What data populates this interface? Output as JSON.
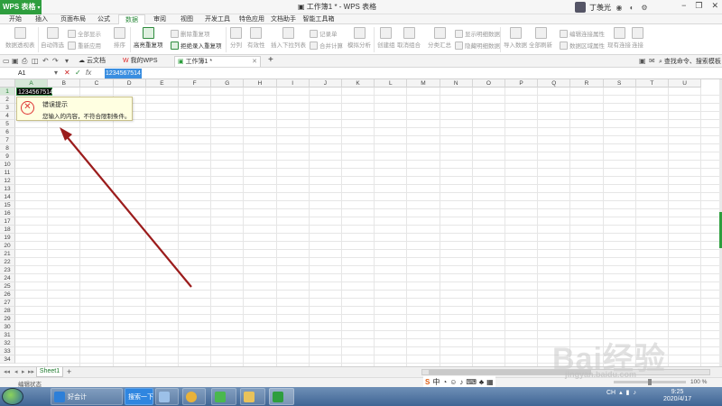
{
  "app": {
    "badge": "WPS 表格",
    "document_title": "工作簿1 * - WPS 表格",
    "user_name": "丁羡光"
  },
  "menu_tabs": [
    "开始",
    "插入",
    "页面布局",
    "公式",
    "数据",
    "审阅",
    "视图",
    "开发工具",
    "特色应用",
    "文档助手",
    "智能工具箱"
  ],
  "active_tab": "数据",
  "ribbon": {
    "pivot": "数据透视表",
    "auto_filter": "自动筛选",
    "show_all": "全部显示",
    "reapply": "重新应用",
    "sort": "排序",
    "highlight_duplicates": "高亮重复项",
    "delete_duplicates": "删除重复项",
    "reject_duplicates": "拒绝录入重复项",
    "text_to_columns": "分列",
    "validation": "有效性",
    "insert_dropdown": "插入下拉列表",
    "record_sheet": "记录单",
    "consolidate": "合并计算",
    "whatif": "模拟分析",
    "create_group": "创建组",
    "ungroup": "取消组合",
    "subtotal": "分类汇总",
    "show_detail": "显示明细数据",
    "hide_detail": "隐藏明细数据",
    "import_data": "导入数据",
    "refresh_all": "全部刷新",
    "edit_links": "编辑连接属性",
    "data_region_props": "数据区域属性",
    "existing_connections": "现有连接",
    "connections": "连接"
  },
  "doc_tabs": {
    "cloud": "云文档",
    "my_wps": "我的WPS",
    "workbook": "工作簿1 *",
    "search_placeholder": "查找命令、搜索模板"
  },
  "formula_bar": {
    "cell_ref": "A1",
    "value": "1234567514"
  },
  "grid": {
    "columns": [
      "A",
      "B",
      "C",
      "D",
      "E",
      "F",
      "G",
      "H",
      "I",
      "J",
      "K",
      "L",
      "M",
      "N",
      "O",
      "P",
      "Q",
      "R",
      "S",
      "T",
      "U"
    ],
    "rows": [
      "1",
      "2",
      "3",
      "4",
      "5",
      "6",
      "7",
      "8",
      "9",
      "10",
      "11",
      "12",
      "13",
      "14",
      "15",
      "16",
      "17",
      "18",
      "19",
      "20",
      "21",
      "22",
      "23",
      "24",
      "25",
      "26",
      "27",
      "28",
      "29",
      "30",
      "31",
      "32",
      "33",
      "34"
    ],
    "a1_value": "1234567514"
  },
  "error_tip": {
    "title": "错误提示",
    "message": "您输入的内容，不符合限制条件。"
  },
  "sheet_tab": "Sheet1",
  "status": {
    "mode": "编辑状态",
    "zoom": "100 %"
  },
  "ime": {
    "logo": "S",
    "mode": "中"
  },
  "taskbar": {
    "ie_label": "好会计",
    "search_label": "搜索一下",
    "time": "9:25",
    "date": "2020/4/17",
    "tray_lang": "CH"
  },
  "watermark": {
    "main": "Bai经验",
    "sub": "jingyan.baidu.com"
  },
  "colors": {
    "accent": "#2e9e3e",
    "arrow": "#9b1c1c",
    "selection": "#3a8ee0"
  }
}
